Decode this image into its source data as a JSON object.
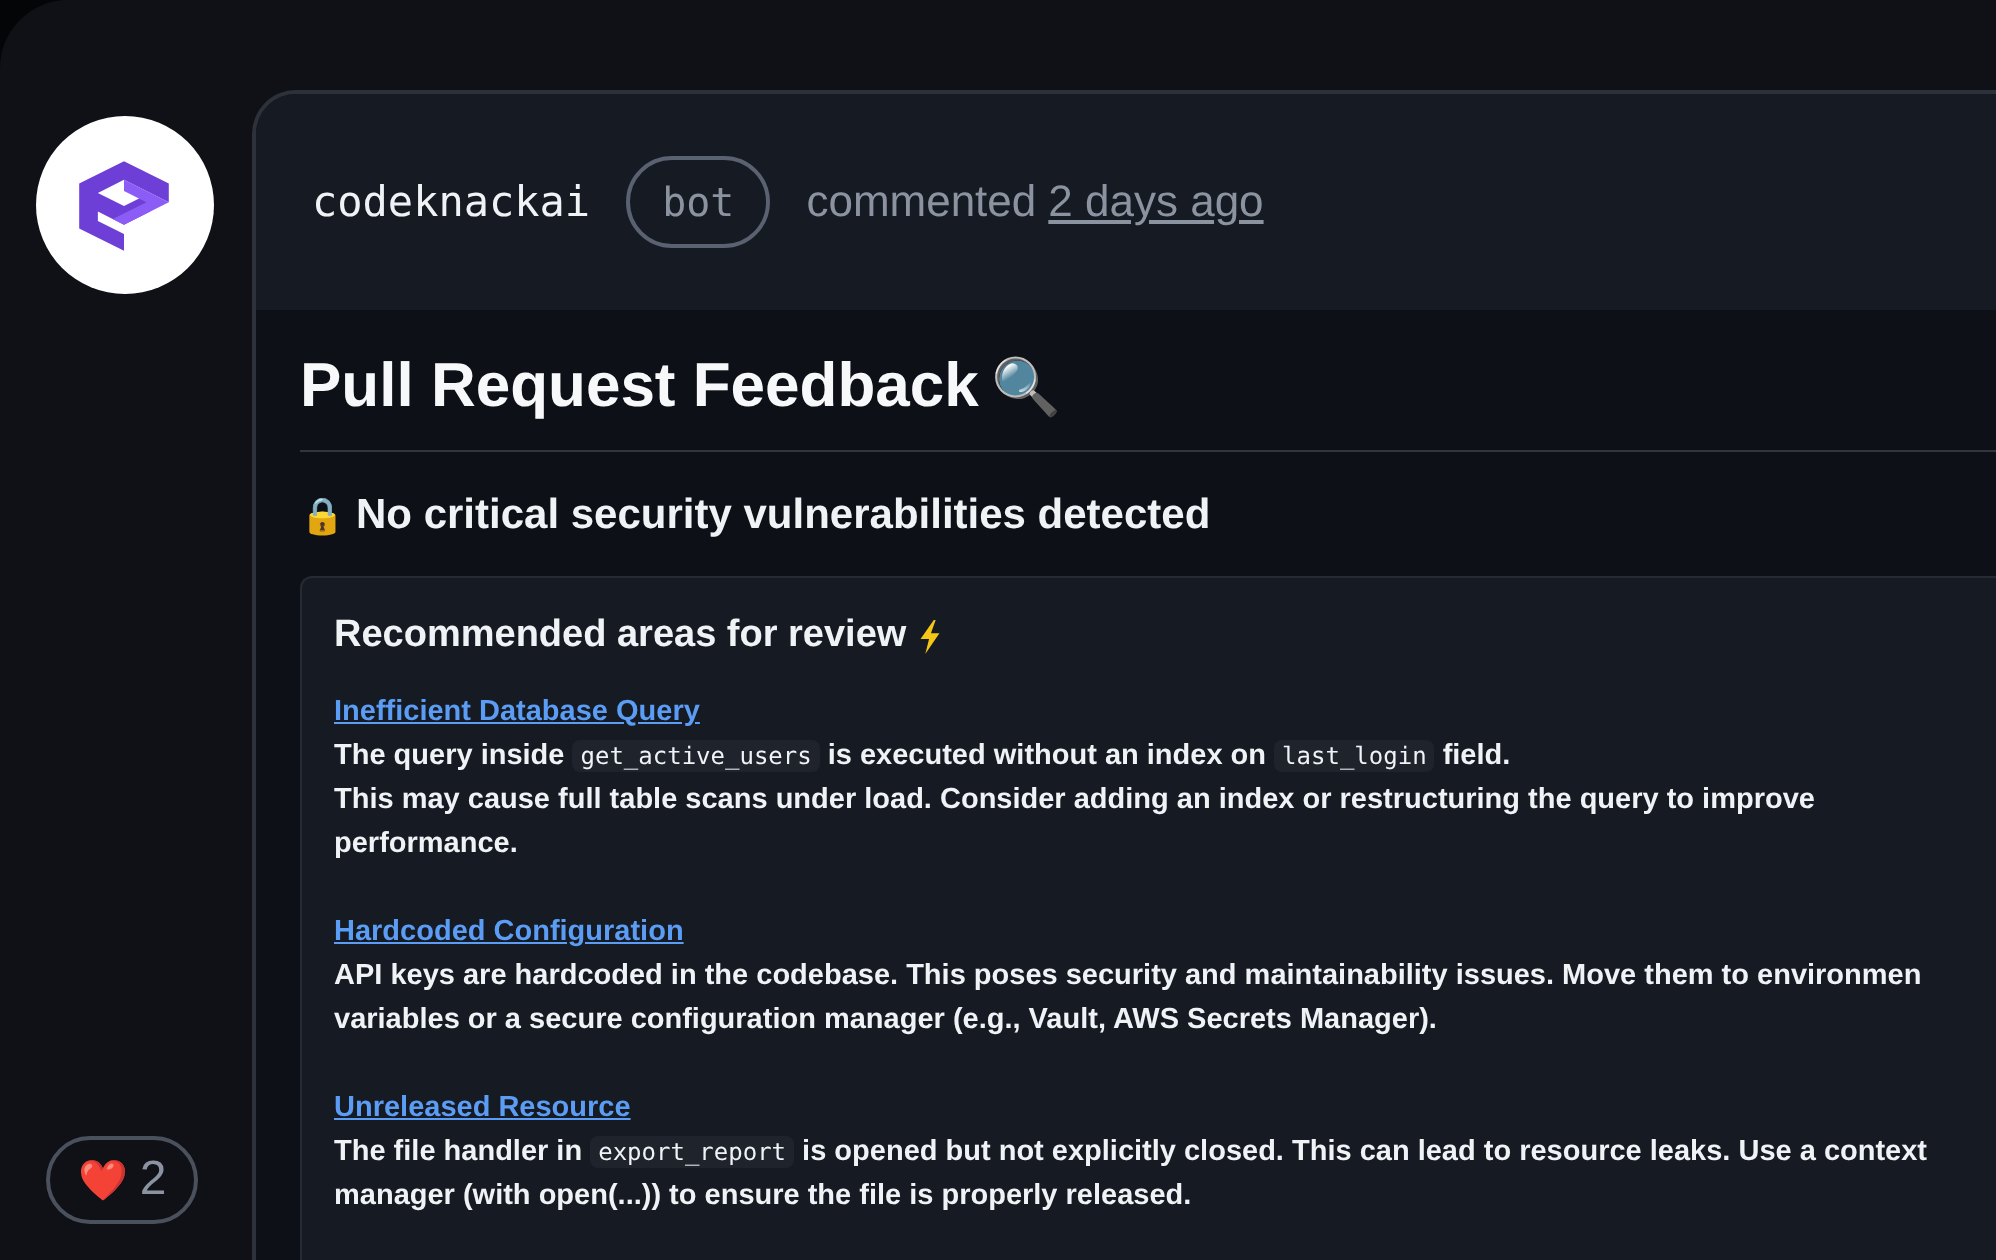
{
  "comment": {
    "author": "codeknackai",
    "badge": "bot",
    "action": "commented",
    "time": "2 days ago"
  },
  "title": "Pull Request Feedback",
  "title_emoji": "🔍",
  "status": {
    "emoji": "🔒",
    "text": "No critical security vulnerabilities detected"
  },
  "review": {
    "heading": "Recommended areas for review",
    "items": [
      {
        "title": "Inefficient Database Query",
        "lines": [
          [
            {
              "kind": "text",
              "text": "The query inside "
            },
            {
              "kind": "code",
              "text": "get_active_users"
            },
            {
              "kind": "text",
              "text": " is executed without an index on "
            },
            {
              "kind": "code",
              "text": "last_login"
            },
            {
              "kind": "text",
              "text": " field."
            }
          ],
          [
            {
              "kind": "text",
              "text": "This may cause full table scans under load. Consider adding an index or restructuring the query to improve"
            }
          ],
          [
            {
              "kind": "text",
              "text": "performance."
            }
          ]
        ]
      },
      {
        "title": "Hardcoded Configuration",
        "lines": [
          [
            {
              "kind": "text",
              "text": "API keys are hardcoded in the codebase. This poses security and maintainability issues. Move them to environmen"
            }
          ],
          [
            {
              "kind": "text",
              "text": "variables or a secure configuration manager (e.g., Vault, AWS Secrets Manager)."
            }
          ]
        ]
      },
      {
        "title": "Unreleased Resource",
        "lines": [
          [
            {
              "kind": "text",
              "text": "The file handler in "
            },
            {
              "kind": "code",
              "text": "export_report"
            },
            {
              "kind": "text",
              "text": " is opened but not explicitly closed. This can lead to resource leaks. Use a context"
            }
          ],
          [
            {
              "kind": "text",
              "text": "manager (with open(...)) to ensure the file is properly released."
            }
          ]
        ]
      }
    ]
  },
  "reaction": {
    "emoji": "❤️",
    "count": "2"
  }
}
